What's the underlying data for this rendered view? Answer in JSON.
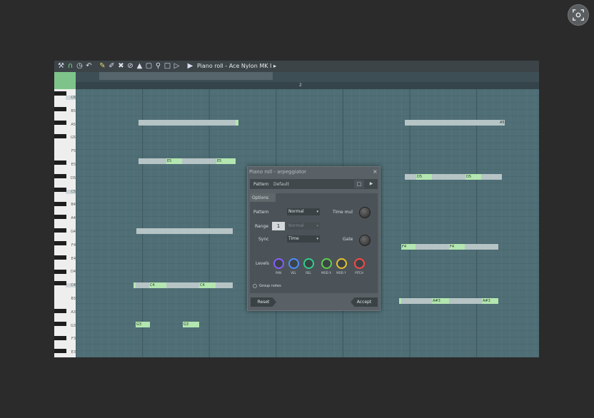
{
  "window": {
    "title": "Piano roll - Ace Nylon MK I",
    "title_arrow": "▸",
    "ruler_mark": "2"
  },
  "toolbar": {
    "icons": [
      "wrench-icon",
      "magnet-icon",
      "clock-icon",
      "undo-icon",
      "pencil-icon",
      "brush-icon",
      "delete-icon",
      "mute-icon",
      "speaker-icon",
      "select-icon",
      "zoom-icon",
      "playback-icon"
    ]
  },
  "keys": [
    "C6",
    "B5",
    "A5",
    "G5",
    "F5",
    "E5",
    "D5",
    "C5",
    "B4",
    "A4",
    "G4",
    "F4",
    "E4",
    "D4",
    "C4",
    "B3",
    "A3",
    "G3",
    "F3",
    "E3"
  ],
  "notes": {
    "a5_right": "A5",
    "e5_1": "E5",
    "e5_2": "E5",
    "d5_1": "D5",
    "d5_2": "D5",
    "f4_1": "F4",
    "f4_2": "F4",
    "c4_1": "C4",
    "c4_2": "C4",
    "as3_1": "A#3",
    "as3_2": "A#3",
    "g3_1": "G3",
    "g3_2": "G3"
  },
  "dialog": {
    "title": "Piano roll - arpeggiator",
    "close": "×",
    "pattern_label": "Pattern",
    "pattern_value": "Default",
    "options_tab": "Options",
    "opt_pattern_label": "Pattern",
    "opt_pattern_value": "Normal",
    "time_mul_label": "Time mul",
    "range_label": "Range",
    "range_value": "1",
    "range_mode": "Normal",
    "sync_label": "Sync",
    "sync_value": "Time",
    "gate_label": "Gate",
    "levels_label": "Levels",
    "levels": [
      {
        "name": "PAN",
        "color": "#8a5cff"
      },
      {
        "name": "VEL",
        "color": "#4c8dff"
      },
      {
        "name": "REL",
        "color": "#2fd08a"
      },
      {
        "name": "MOD X",
        "color": "#5fd04a"
      },
      {
        "name": "MOD Y",
        "color": "#e8c22e"
      },
      {
        "name": "PITCH",
        "color": "#ff4646"
      }
    ],
    "group_notes_label": "Group notes",
    "reset_label": "Reset",
    "accept_label": "Accept"
  }
}
